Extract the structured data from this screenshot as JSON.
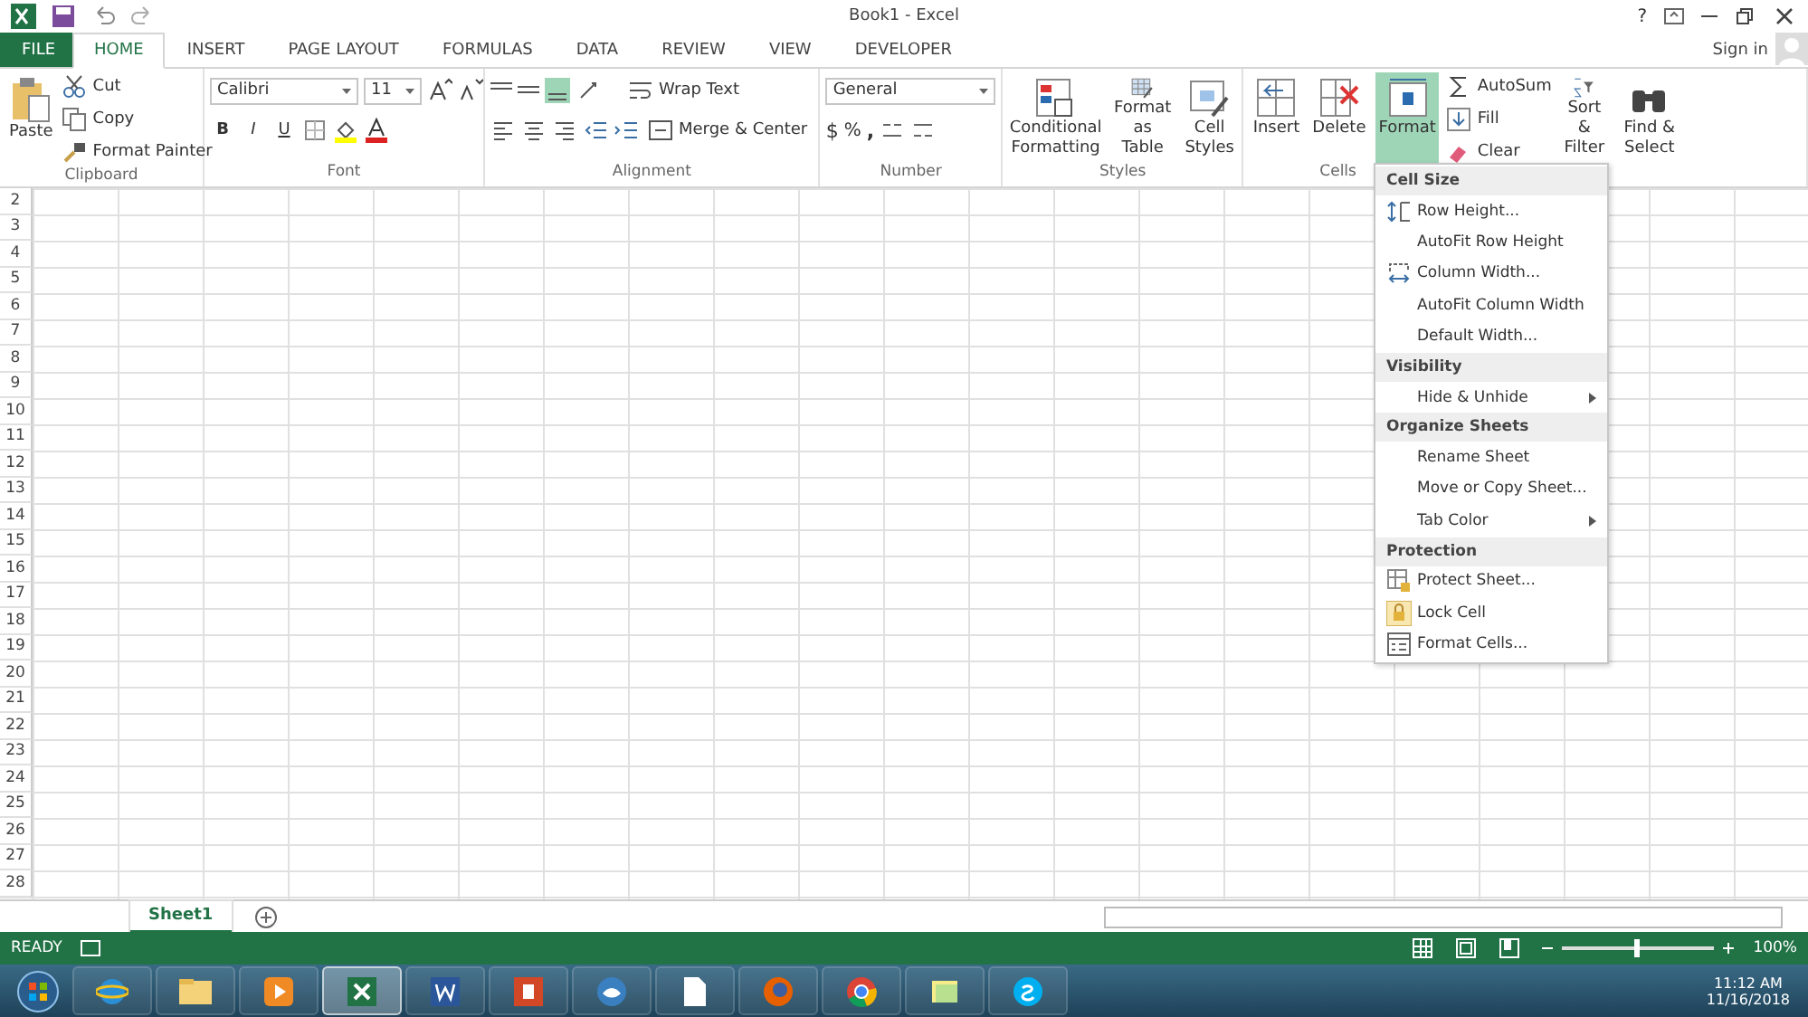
{
  "window": {
    "title": "Book1 - Excel",
    "help": "?",
    "sign_in": "Sign in"
  },
  "tabs": [
    {
      "label": "FILE",
      "kind": "file",
      "selected": false
    },
    {
      "label": "HOME",
      "kind": "tab",
      "selected": true
    },
    {
      "label": "INSERT",
      "kind": "tab",
      "selected": false
    },
    {
      "label": "PAGE LAYOUT",
      "kind": "tab",
      "selected": false
    },
    {
      "label": "FORMULAS",
      "kind": "tab",
      "selected": false
    },
    {
      "label": "DATA",
      "kind": "tab",
      "selected": false
    },
    {
      "label": "REVIEW",
      "kind": "tab",
      "selected": false
    },
    {
      "label": "VIEW",
      "kind": "tab",
      "selected": false
    },
    {
      "label": "DEVELOPER",
      "kind": "tab",
      "selected": false
    }
  ],
  "clipboard": {
    "label": "Clipboard",
    "paste": "Paste",
    "cut": "Cut",
    "copy": "Copy",
    "format_painter": "Format Painter"
  },
  "font": {
    "label": "Font",
    "font_name": "Calibri",
    "font_size": "11",
    "bold": "B",
    "italic": "I",
    "underline": "U"
  },
  "alignment": {
    "label": "Alignment",
    "wrap_text": "Wrap Text",
    "merge": "Merge & Center"
  },
  "number": {
    "label": "Number",
    "format": "General",
    "currency": "$",
    "percent": "%",
    "comma": ","
  },
  "styles": {
    "label": "Styles",
    "buttons": [
      {
        "label": "Conditional Formatting"
      },
      {
        "label": "Format as Table"
      },
      {
        "label": "Cell Styles"
      }
    ]
  },
  "cells": {
    "label": "Cells",
    "buttons": [
      {
        "label": "Insert",
        "selected": false
      },
      {
        "label": "Delete",
        "selected": false
      },
      {
        "label": "Format",
        "selected": true
      }
    ]
  },
  "editing": {
    "autosum": "AutoSum",
    "fill": "Fill",
    "clear": "Clear",
    "sort": "Sort & Filter",
    "find": "Find & Select"
  },
  "rows": [
    "2",
    "3",
    "4",
    "5",
    "6",
    "7",
    "8",
    "9",
    "10",
    "11",
    "12",
    "13",
    "14",
    "15",
    "16",
    "17",
    "18",
    "19",
    "20",
    "21",
    "22",
    "23",
    "24",
    "25",
    "26",
    "27",
    "28"
  ],
  "format_menu": [
    {
      "kind": "header",
      "label": "Cell Size"
    },
    {
      "kind": "item",
      "label": "Row Height..."
    },
    {
      "kind": "item",
      "label": "AutoFit Row Height"
    },
    {
      "kind": "item",
      "label": "Column Width..."
    },
    {
      "kind": "item",
      "label": "AutoFit Column Width"
    },
    {
      "kind": "item",
      "label": "Default Width..."
    },
    {
      "kind": "header",
      "label": "Visibility"
    },
    {
      "kind": "item",
      "label": "Hide & Unhide",
      "submenu": true
    },
    {
      "kind": "header",
      "label": "Organize Sheets"
    },
    {
      "kind": "item",
      "label": "Rename Sheet"
    },
    {
      "kind": "item",
      "label": "Move or Copy Sheet..."
    },
    {
      "kind": "item",
      "label": "Tab Color",
      "submenu": true
    },
    {
      "kind": "header",
      "label": "Protection"
    },
    {
      "kind": "item",
      "label": "Protect Sheet..."
    },
    {
      "kind": "item",
      "label": "Lock Cell"
    },
    {
      "kind": "item",
      "label": "Format Cells..."
    }
  ],
  "sheets": [
    {
      "label": "Sheet1",
      "selected": true
    }
  ],
  "status_bar": {
    "state": "READY",
    "zoom": "100%",
    "zoom_level": {
      "level": 0.5
    }
  },
  "taskbar": {
    "apps": [
      {
        "kind": "ie",
        "selected": false
      },
      {
        "kind": "folder",
        "selected": false
      },
      {
        "kind": "media",
        "selected": false
      },
      {
        "kind": "excel",
        "selected": true
      },
      {
        "kind": "word",
        "selected": false
      },
      {
        "kind": "powerpoint",
        "selected": false
      },
      {
        "kind": "mail",
        "selected": false
      },
      {
        "kind": "file",
        "selected": false
      },
      {
        "kind": "firefox",
        "selected": false
      },
      {
        "kind": "chrome",
        "selected": false
      },
      {
        "kind": "notes",
        "selected": false
      },
      {
        "kind": "skype",
        "selected": false
      }
    ],
    "time": "11:12 AM",
    "date": "11/16/2018"
  }
}
